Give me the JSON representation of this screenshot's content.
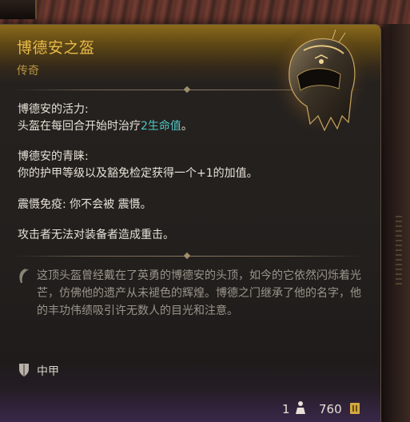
{
  "item": {
    "name": "博德安之盔",
    "rarity": "传奇",
    "rarity_color": "#e8b94a"
  },
  "effects": [
    {
      "title": "博德安的活力:",
      "desc_prefix": "头盔在每回合开始时治疗",
      "desc_highlight": "2生命值",
      "desc_suffix": "。",
      "highlight_color": "#4fc6c3"
    },
    {
      "title": "博德安的青睐:",
      "desc": "你的护甲等级以及豁免检定获得一个+1的加值。"
    },
    {
      "line": "震慑免疫: 你不会被 震慑。"
    },
    {
      "line": "攻击者无法对装备者造成重击。"
    }
  ],
  "lore": {
    "icon": "quill-icon",
    "text": "这顶头盔曾经戴在了英勇的博德安的头顶，如今的它依然闪烁着光芒，仿佛他的遗产从未褪色的辉煌。博德之门继承了他的名字，他的丰功伟绩吸引许无数人的目光和注意。"
  },
  "armor": {
    "icon": "shield-icon",
    "type": "中甲"
  },
  "footer": {
    "weight": "1",
    "weight_icon": "weight-icon",
    "price": "760",
    "price_icon": "gold-coin-icon"
  }
}
